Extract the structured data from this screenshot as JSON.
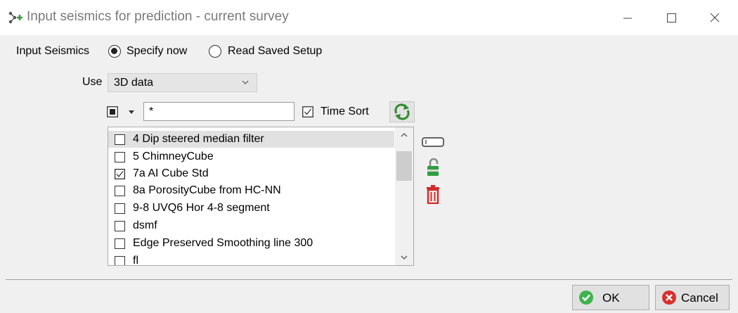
{
  "window": {
    "title": "Input seismics for prediction - current survey",
    "icon": "odin-plus-icon",
    "controls": {
      "minimize": "minimize-icon",
      "maximize": "maximize-icon",
      "close": "close-icon"
    }
  },
  "input_seismics": {
    "label": "Input Seismics",
    "options": [
      {
        "label": "Specify now",
        "selected": true
      },
      {
        "label": "Read Saved Setup",
        "selected": false
      }
    ]
  },
  "use": {
    "label": "Use",
    "selected": "3D data"
  },
  "filter": {
    "value": "*",
    "time_sort_label": "Time Sort",
    "time_sort_checked": true
  },
  "list": {
    "items": [
      {
        "label": "4 Dip steered median filter",
        "checked": false,
        "selected": true
      },
      {
        "label": "5 ChimneyCube",
        "checked": false,
        "selected": false
      },
      {
        "label": "7a AI Cube Std",
        "checked": true,
        "selected": false
      },
      {
        "label": "8a PorosityCube from HC-NN",
        "checked": false,
        "selected": false
      },
      {
        "label": "9-8 UVQ6 Hor 4-8 segment",
        "checked": false,
        "selected": false
      },
      {
        "label": "dsmf",
        "checked": false,
        "selected": false
      },
      {
        "label": "Edge Preserved Smoothing line 300",
        "checked": false,
        "selected": false
      },
      {
        "label": "fl",
        "checked": false,
        "selected": false
      }
    ]
  },
  "side_icons": [
    "rename-icon",
    "unlock-icon",
    "delete-icon"
  ],
  "buttons": {
    "ok": "OK",
    "cancel": "Cancel"
  },
  "colors": {
    "ok_green": "#3fb34f",
    "cancel_red": "#d9302c",
    "delete_red": "#d42a2a",
    "lock_green": "#2e9e3e"
  }
}
